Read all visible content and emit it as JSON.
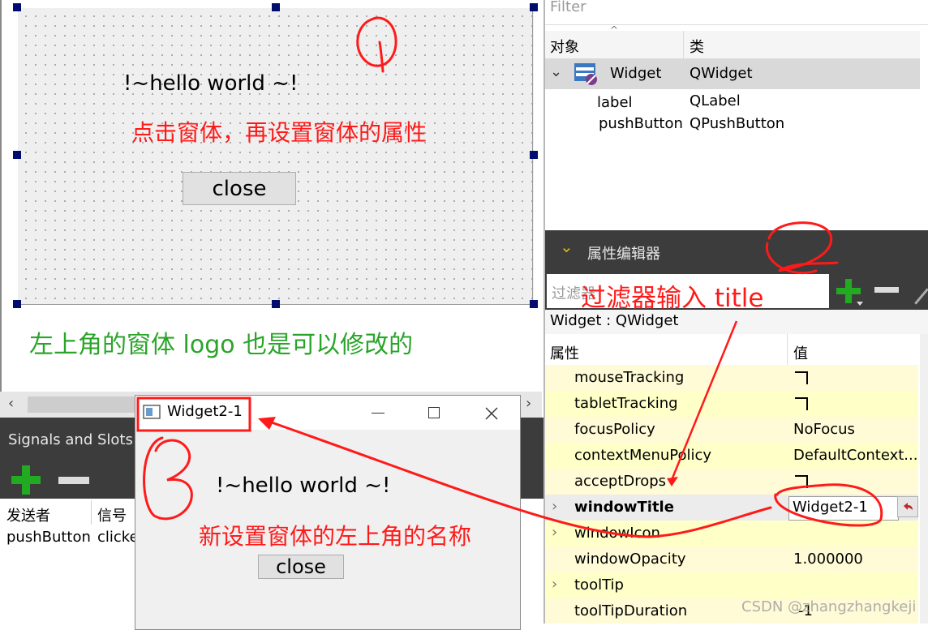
{
  "form": {
    "label_text": "!~hello  world ~!",
    "button_text": "close"
  },
  "annotations": {
    "step1_text": "点击窗体，再设置窗体的属性",
    "step2_text": "过滤器输入 title",
    "step3_text": "新设置窗体的左上角的名称",
    "logo_note": "左上角的窗体 logo 也是可以修改的",
    "watermark": "CSDN @zhangzhangkeji"
  },
  "object_inspector": {
    "filter_placeholder": "Filter",
    "columns": [
      "对象",
      "类"
    ],
    "rows": [
      {
        "name": "Widget",
        "class": "QWidget"
      },
      {
        "name": "label",
        "class": "QLabel"
      },
      {
        "name": "pushButton",
        "class": "QPushButton"
      }
    ]
  },
  "property_editor": {
    "title": "属性编辑器",
    "filter_value": "过滤器",
    "object_label": "Widget : QWidget",
    "columns": [
      "属性",
      "值"
    ],
    "rows": [
      {
        "name": "mouseTracking",
        "value": ""
      },
      {
        "name": "tabletTracking",
        "value": ""
      },
      {
        "name": "focusPolicy",
        "value": "NoFocus"
      },
      {
        "name": "contextMenuPolicy",
        "value": "DefaultContext..."
      },
      {
        "name": "acceptDrops",
        "value": ""
      },
      {
        "name": "windowTitle",
        "value": "Widget2-1"
      },
      {
        "name": "windowIcon",
        "value": ""
      },
      {
        "name": "windowOpacity",
        "value": "1.000000"
      },
      {
        "name": "toolTip",
        "value": ""
      },
      {
        "name": "toolTipDuration",
        "value": "-1"
      }
    ]
  },
  "signals_slots": {
    "title": "Signals and Slots E",
    "columns": [
      "发送者",
      "信号"
    ],
    "row": {
      "sender": "pushButton",
      "signal": "clicke"
    }
  },
  "preview_window": {
    "title": "Widget2-1",
    "label_text": "!~hello  world ~!",
    "button_text": "close"
  },
  "colors": {
    "annotation_red": "#ff1a1a",
    "annotation_green": "#2aa52a",
    "add_green": "#22aa22",
    "selection_handle": "#000c6e",
    "property_row": "#fffbd6"
  }
}
